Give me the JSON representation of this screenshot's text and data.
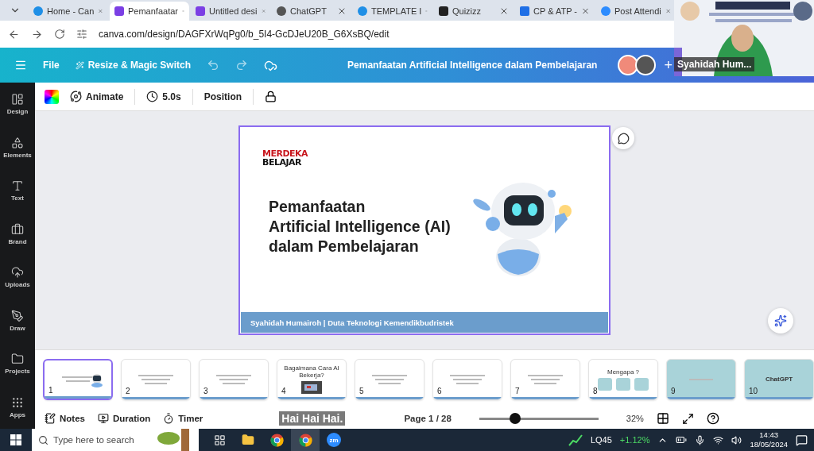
{
  "browser": {
    "tabs": [
      {
        "label": "Home - Can",
        "kind": "canva",
        "selected": false
      },
      {
        "label": "Pemanfaatar",
        "kind": "design",
        "selected": true
      },
      {
        "label": "Untitled desi",
        "kind": "design",
        "selected": false
      },
      {
        "label": "ChatGPT",
        "kind": "chatgpt",
        "selected": false
      },
      {
        "label": "TEMPLATE I",
        "kind": "canva",
        "selected": false
      },
      {
        "label": "Quizizz",
        "kind": "quizizz",
        "selected": false
      },
      {
        "label": "CP & ATP -",
        "kind": "check",
        "selected": false
      },
      {
        "label": "Post Attendi",
        "kind": "zoom",
        "selected": false
      }
    ],
    "url": "canva.com/design/DAGFXrWqPg0/b_5I4-GcDJeU20B_G6XsBQ/edit"
  },
  "header": {
    "file": "File",
    "resize": "Resize & Magic Switch",
    "title": "Pemanfaatan Artificial Intelligence dalam Pembelajaran",
    "add": "+"
  },
  "video": {
    "kind": "picture",
    "name": "Syahidah Hum..."
  },
  "toolbar": {
    "animate": "Animate",
    "duration": "5.0s",
    "position": "Position"
  },
  "sidebar": {
    "items": [
      {
        "label": "Design",
        "kind": "design"
      },
      {
        "label": "Elements",
        "kind": "elements"
      },
      {
        "label": "Text",
        "kind": "text"
      },
      {
        "label": "Brand",
        "kind": "brand"
      },
      {
        "label": "Uploads",
        "kind": "uploads"
      },
      {
        "label": "Draw",
        "kind": "draw"
      },
      {
        "label": "Projects",
        "kind": "projects"
      },
      {
        "label": "Apps",
        "kind": "apps"
      }
    ]
  },
  "slide": {
    "logo_top": "MERDEKA",
    "logo_bottom": "BELAJAR",
    "title_lines": [
      "Pemanfaatan",
      "Artificial Intelligence (AI)",
      "dalam Pembelajaran"
    ],
    "footer": "Syahidah Humairoh  | Duta Teknologi Kemendikbudristek"
  },
  "thumbnails": [
    {
      "number": "1",
      "kind": "robot",
      "selected": true
    },
    {
      "number": "2",
      "kind": "lines",
      "selected": false
    },
    {
      "number": "3",
      "kind": "lines",
      "selected": false
    },
    {
      "number": "4",
      "title": "Bagaimana Cara AI Bekerja?",
      "selected": false
    },
    {
      "number": "5",
      "kind": "lines",
      "selected": false
    },
    {
      "number": "6",
      "kind": "lines",
      "selected": false
    },
    {
      "number": "7",
      "kind": "lines",
      "selected": false
    },
    {
      "number": "8",
      "kind": "boxes",
      "title": "Mengapa ?",
      "selected": false
    },
    {
      "number": "9",
      "kind": "teal",
      "selected": false
    },
    {
      "number": "10",
      "kind": "teal",
      "title": "ChatGPT",
      "selected": false
    }
  ],
  "bottom_bar": {
    "notes": "Notes",
    "duration": "Duration",
    "timer": "Timer",
    "caption": "Hai Hai Hai.",
    "page": "Page 1 / 28",
    "zoom": {
      "level": 0.3
    },
    "zoom_reading": "32%"
  },
  "taskbar": {
    "search_placeholder": "Type here to search",
    "apps": [
      {
        "kind": "taskview",
        "selected": false
      },
      {
        "kind": "explorer",
        "selected": false
      },
      {
        "kind": "chrome",
        "selected": false
      },
      {
        "kind": "chrome",
        "selected": true
      },
      {
        "kind": "zoom",
        "label": "zm",
        "selected": false
      }
    ],
    "ticker": "LQ45",
    "change": "+1.12%",
    "time": "14:43",
    "date": "18/05/2024"
  }
}
